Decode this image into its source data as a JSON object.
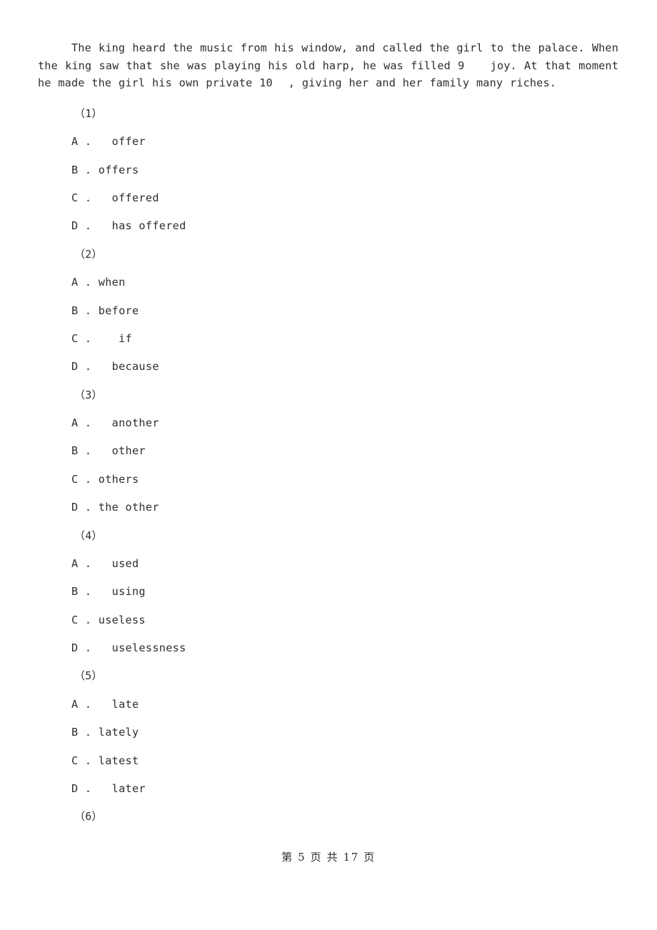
{
  "document": {
    "background_color": "#ffffff",
    "text_color": "#2e2e2e"
  },
  "passage": {
    "segment_1": "The king heard the music from his window, and called the girl to the palace. When the king saw that she was playing his old harp, he was filled ",
    "blank_9": "9",
    "segment_2": " joy. At that moment he made the girl his own private ",
    "blank_10": "10",
    "segment_3": ", giving her and her family many riches."
  },
  "questions": [
    {
      "number": "（1）",
      "options": [
        "A .   offer",
        "B . offers",
        "C .   offered",
        "D .   has offered"
      ]
    },
    {
      "number": "（2）",
      "options": [
        "A . when",
        "B . before",
        "C .    if",
        "D .   because"
      ]
    },
    {
      "number": "（3）",
      "options": [
        "A .   another",
        "B .   other",
        "C . others",
        "D . the other"
      ]
    },
    {
      "number": "（4）",
      "options": [
        "A .   used",
        "B .   using",
        "C . useless",
        "D .   uselessness"
      ]
    },
    {
      "number": "（5）",
      "options": [
        "A .   late",
        "B . lately",
        "C . latest",
        "D .   later"
      ]
    },
    {
      "number": "（6）",
      "options": []
    }
  ],
  "footer": {
    "text": "第 5 页 共 17 页",
    "current_page": "5",
    "total_pages": "17"
  }
}
